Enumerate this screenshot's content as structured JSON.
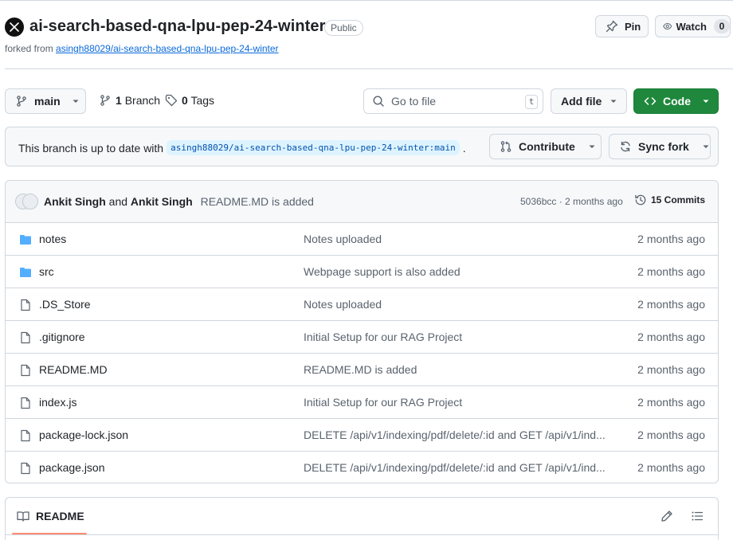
{
  "repo": {
    "name": "ai-search-based-qna-lpu-pep-24-winter",
    "visibility": "Public",
    "forked_prefix": "forked from",
    "forked_from": "asingh88029/ai-search-based-qna-lpu-pep-24-winter"
  },
  "actions": {
    "pin_label": "Pin",
    "watch_label": "Watch",
    "watch_count": "0"
  },
  "toolbar": {
    "branch": "main",
    "branches_count": "1",
    "branches_label": "Branch",
    "tags_count": "0",
    "tags_label": "Tags",
    "goto_placeholder": "Go to file",
    "goto_shortcut": "t",
    "add_file_label": "Add file",
    "code_label": "Code"
  },
  "status": {
    "text": "This branch is up to date with",
    "branch_ref": "asingh88029/ai-search-based-qna-lpu-pep-24-winter:main",
    "suffix": ".",
    "contribute_label": "Contribute",
    "sync_fork_label": "Sync fork"
  },
  "latest_commit": {
    "author1": "Ankit Singh",
    "and_text": "and",
    "author2": "Ankit Singh",
    "message": "README.MD is added",
    "meta": "5036bcc · 2 months ago",
    "commits_label": "15 Commits"
  },
  "files": [
    {
      "name": "notes",
      "type": "folder",
      "message": "Notes uploaded",
      "date": "2 months ago"
    },
    {
      "name": "src",
      "type": "folder",
      "message": "Webpage support is also added",
      "date": "2 months ago"
    },
    {
      "name": ".DS_Store",
      "type": "file",
      "message": "Notes uploaded",
      "date": "2 months ago"
    },
    {
      "name": ".gitignore",
      "type": "file",
      "message": "Initial Setup for our RAG Project",
      "date": "2 months ago"
    },
    {
      "name": "README.MD",
      "type": "file",
      "message": "README.MD is added",
      "date": "2 months ago"
    },
    {
      "name": "index.js",
      "type": "file",
      "message": "Initial Setup for our RAG Project",
      "date": "2 months ago"
    },
    {
      "name": "package-lock.json",
      "type": "file",
      "message": "DELETE /api/v1/indexing/pdf/delete/:id and GET /api/v1/ind...",
      "date": "2 months ago"
    },
    {
      "name": "package.json",
      "type": "file",
      "message": "DELETE /api/v1/indexing/pdf/delete/:id and GET /api/v1/ind...",
      "date": "2 months ago"
    }
  ],
  "readme": {
    "tab_label": "README"
  },
  "colors": {
    "accent_blue": "#0969da",
    "folder_blue": "#54aeff",
    "code_green": "#1f883d",
    "tab_underline": "#fd8c73"
  }
}
